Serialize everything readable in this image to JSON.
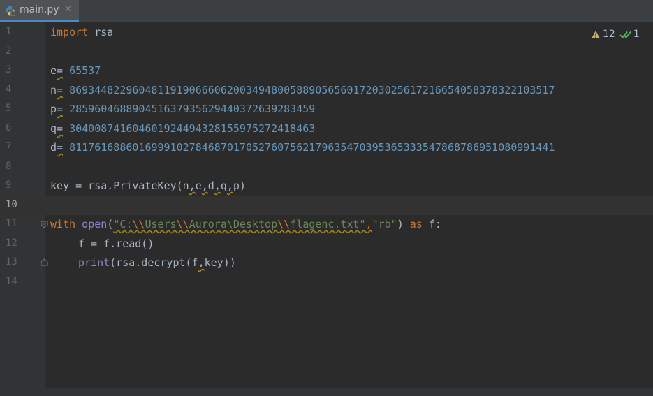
{
  "tab": {
    "filename": "main.py",
    "close_glyph": "✕"
  },
  "inspections": {
    "warnings": "12",
    "weak_warnings": "1"
  },
  "lines": {
    "n1": "1",
    "n2": "2",
    "n3": "3",
    "n4": "4",
    "n5": "5",
    "n6": "6",
    "n7": "7",
    "n8": "8",
    "n9": "9",
    "n10": "10",
    "n11": "11",
    "n12": "12",
    "n13": "13",
    "n14": "14"
  },
  "code": {
    "l1": {
      "kw": "import",
      "rest": " rsa"
    },
    "l3": {
      "name": "e",
      "eq": "=",
      "value": "65537"
    },
    "l4": {
      "name": "n",
      "eq": "=",
      "value": "86934482296048119190666062003494800588905656017203025617216654058378322103517"
    },
    "l5": {
      "name": "p",
      "eq": "=",
      "value": "285960468890451637935629440372639283459"
    },
    "l6": {
      "name": "q",
      "eq": "=",
      "value": "304008741604601924494328155975272418463"
    },
    "l7": {
      "name": "d",
      "eq": "=",
      "value": "81176168860169991027846870170527607562179635470395365333547868786951080991441"
    },
    "l9": {
      "a": "key = rsa.PrivateKey(n",
      "c1": ",",
      "b": "e",
      "c2": ",",
      "c": "d",
      "c3": ",",
      "d": "q",
      "c4": ",",
      "e": "p)"
    },
    "l11": {
      "kw1": "with",
      "sp": " ",
      "fn": "open",
      "paren": "(",
      "s1": "\"C:",
      "s2": "\\\\",
      "s3": "Users",
      "s4": "\\\\",
      "s5": "Aurora",
      "s6": "\\",
      "s7": "Desktop",
      "s8": "\\\\",
      "s9": "flagenc.txt\"",
      "comma": ",",
      "s10": "\"rb\"",
      "close": ")",
      "kw2": "as",
      "tail": " f:"
    },
    "l12": {
      "text": "f = f.read()"
    },
    "l13": {
      "fn": "print",
      "a": "(rsa.decrypt(f",
      "comma": ",",
      "b": "key))"
    }
  },
  "colors": {
    "background": "#2b2b2b",
    "keyword": "#cc7832",
    "number": "#6897bb",
    "string": "#6a8759",
    "builtin": "#8888c6",
    "text": "#a9b7c6",
    "warning": "#a08a2c"
  },
  "icons": [
    "python-file-icon",
    "close-icon",
    "warning-triangle-icon",
    "double-check-icon",
    "fold-start-icon",
    "fold-end-icon"
  ]
}
